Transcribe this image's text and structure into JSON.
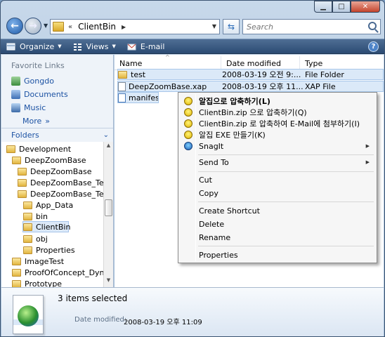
{
  "address": {
    "separator": "«",
    "path": "ClientBin"
  },
  "search": {
    "placeholder": "Search"
  },
  "toolbar": {
    "organize": "Organize",
    "views": "Views",
    "email": "E-mail",
    "help": "?"
  },
  "favorites": {
    "header": "Favorite Links",
    "items": [
      {
        "label": "Gongdo",
        "icon": "user-folder-icon"
      },
      {
        "label": "Documents",
        "icon": "documents-icon"
      },
      {
        "label": "Music",
        "icon": "music-icon"
      }
    ],
    "more": "More"
  },
  "folders": {
    "header": "Folders",
    "tree": [
      {
        "label": "Development"
      },
      {
        "label": "DeepZoomBase"
      },
      {
        "label": "DeepZoomBase"
      },
      {
        "label": "DeepZoomBase_Test"
      },
      {
        "label": "DeepZoomBase_Test_W"
      },
      {
        "label": "App_Data"
      },
      {
        "label": "bin"
      },
      {
        "label": "ClientBin"
      },
      {
        "label": "obj"
      },
      {
        "label": "Properties"
      },
      {
        "label": "ImageTest"
      },
      {
        "label": "ProofOfConcept_Dynami"
      },
      {
        "label": "Prototype"
      }
    ]
  },
  "columns": {
    "name": "Name",
    "date": "Date modified",
    "type": "Type"
  },
  "files": [
    {
      "name": "test",
      "date": "2008-03-19 오전 9:...",
      "type": "File Folder"
    },
    {
      "name": "DeepZoomBase.xap",
      "date": "2008-03-19 오후 11...",
      "type": "XAP File"
    },
    {
      "name": "manifest.xml",
      "date": "",
      "type": ""
    }
  ],
  "context_menu": {
    "items": [
      {
        "label": "알집으로 압축하기(L)",
        "bold": true
      },
      {
        "label": "ClientBin.zip 으로 압축하기(Q)"
      },
      {
        "label": "ClientBin.zip 로 압축하여 E-Mail에 첨부하기(I)"
      },
      {
        "label": "알집 EXE 만들기(K)"
      },
      {
        "label": "SnagIt"
      },
      {
        "label": "Send To"
      },
      {
        "label": "Cut"
      },
      {
        "label": "Copy"
      },
      {
        "label": "Create Shortcut"
      },
      {
        "label": "Delete"
      },
      {
        "label": "Rename"
      },
      {
        "label": "Properties"
      }
    ]
  },
  "details": {
    "selected": "3 items selected",
    "modified_label": "Date modified:",
    "modified_value": "2008-03-19 오후 11:09"
  }
}
